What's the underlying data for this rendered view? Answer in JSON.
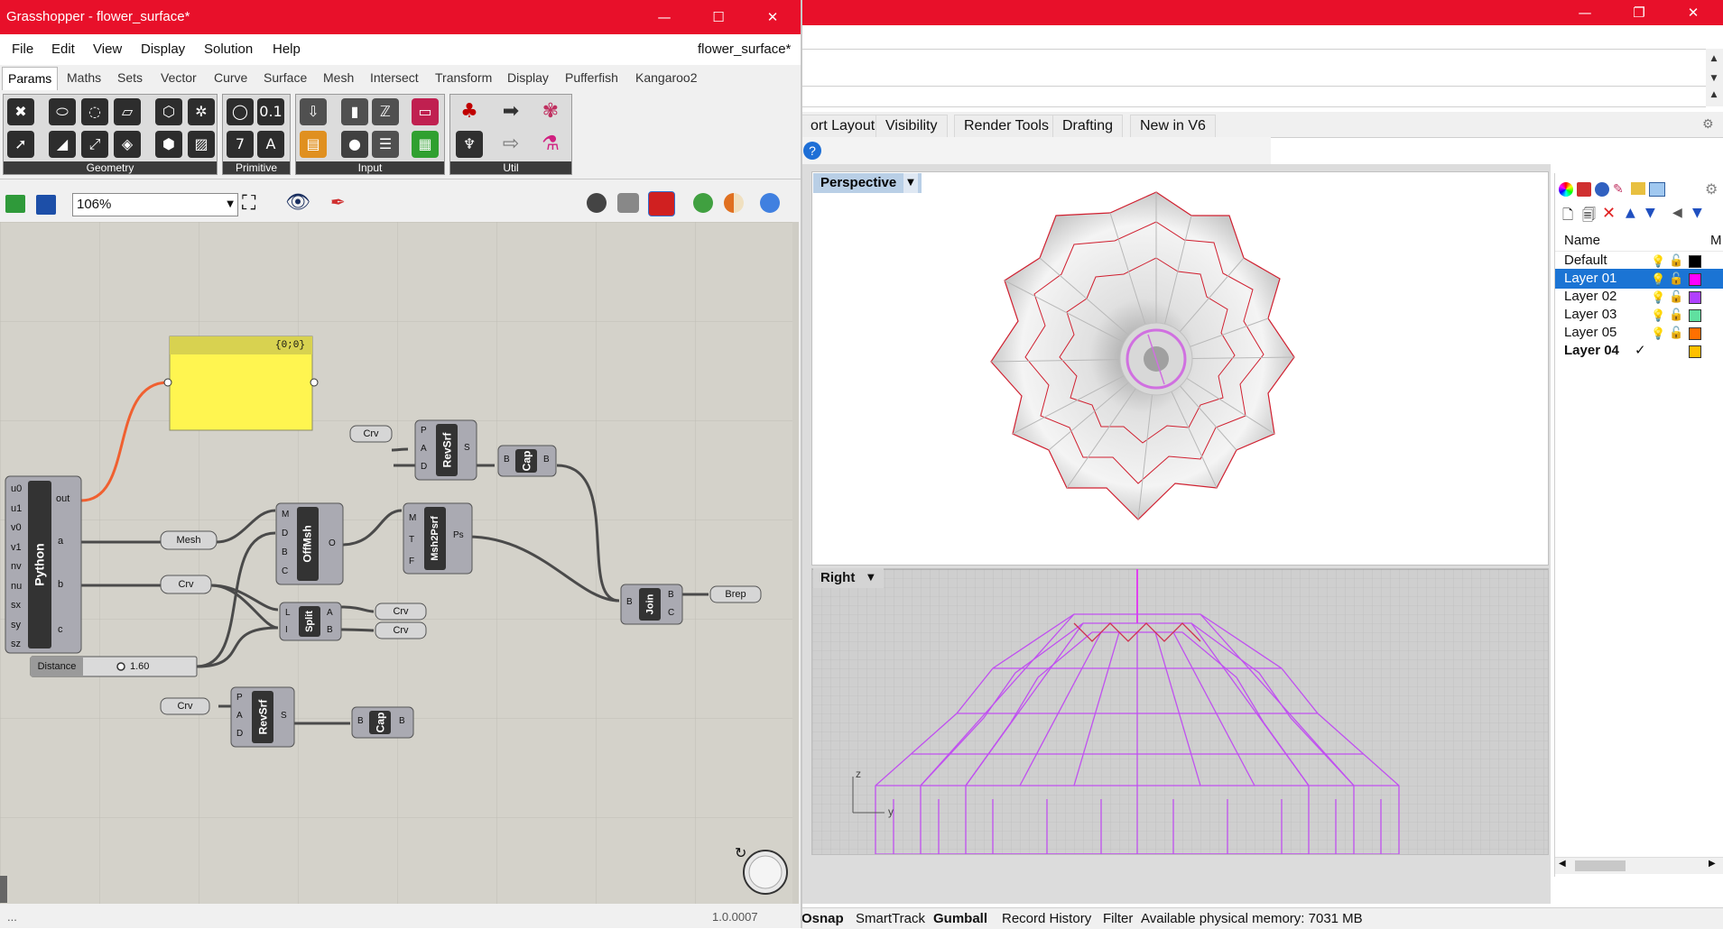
{
  "rhino": {
    "tabs": [
      "ort Layout",
      "Visibility",
      "Render Tools",
      "Drafting",
      "New in V6"
    ],
    "viewports": {
      "top": "Perspective",
      "bottom": "Right"
    },
    "axis_labels": {
      "z": "z",
      "y": "y"
    },
    "layers": {
      "header": {
        "name": "Name",
        "m": "M"
      },
      "rows": [
        {
          "name": "Default",
          "color": "#000000",
          "selected": false,
          "bold": false,
          "check": ""
        },
        {
          "name": "Layer 01",
          "color": "#ff00ff",
          "selected": true,
          "bold": false,
          "check": ""
        },
        {
          "name": "Layer 02",
          "color": "#b040ff",
          "selected": false,
          "bold": false,
          "check": ""
        },
        {
          "name": "Layer 03",
          "color": "#60e0a0",
          "selected": false,
          "bold": false,
          "check": ""
        },
        {
          "name": "Layer 05",
          "color": "#ff7000",
          "selected": false,
          "bold": false,
          "check": ""
        },
        {
          "name": "Layer 04",
          "color": "#ffc000",
          "selected": false,
          "bold": true,
          "check": "✓"
        }
      ]
    },
    "status": {
      "osnap": "Osnap",
      "smarttrack": "SmartTrack",
      "gumball": "Gumball",
      "record_history": "Record History",
      "filter": "Filter",
      "memory": "Available physical memory: 7031 MB"
    },
    "window_buttons": {
      "minimize": "—",
      "restore": "❐",
      "close": "✕"
    }
  },
  "grasshopper": {
    "title": "Grasshopper - flower_surface*",
    "doc_name": "flower_surface*",
    "menu": [
      "File",
      "Edit",
      "View",
      "Display",
      "Solution",
      "Help"
    ],
    "tabs": [
      "Params",
      "Maths",
      "Sets",
      "Vector",
      "Curve",
      "Surface",
      "Mesh",
      "Intersect",
      "Transform",
      "Display",
      "Pufferfish",
      "Kangaroo2"
    ],
    "ribbon_groups": [
      "Geometry",
      "Primitive",
      "Input",
      "Util"
    ],
    "zoom": "106%",
    "version": "1.0.0007",
    "status_left": "...",
    "window_buttons": {
      "minimize": "—",
      "restore": "☐",
      "close": "✕"
    },
    "nodes": {
      "panel_header": "{0;0}",
      "python": {
        "label": "Python",
        "inputs": [
          "u0",
          "u1",
          "v0",
          "v1",
          "nv",
          "nu",
          "sx",
          "sy",
          "sz"
        ],
        "outputs": [
          "out",
          "a",
          "b",
          "c"
        ]
      },
      "mesh": "Mesh",
      "crv": "Crv",
      "distance": {
        "label": "Distance",
        "value": "1.60"
      },
      "revsrf": {
        "label": "RevSrf",
        "inputs": [
          "P",
          "A",
          "D"
        ],
        "output": "S"
      },
      "cap": {
        "label": "Cap",
        "input": "B",
        "output": "B"
      },
      "offmsh": {
        "label": "OffMsh",
        "inputs": [
          "M",
          "D",
          "B",
          "C"
        ],
        "output": "O"
      },
      "msh2psrf": {
        "label": "Msh2Psrf",
        "inputs": [
          "M",
          "T",
          "F"
        ],
        "output": "Ps"
      },
      "split": {
        "label": "Split",
        "inputs": [
          "L",
          "I"
        ],
        "outputs": [
          "A",
          "B"
        ]
      },
      "join": {
        "label": "Join",
        "input": "B",
        "outputs": [
          "B",
          "C"
        ]
      },
      "brep": "Brep"
    }
  }
}
